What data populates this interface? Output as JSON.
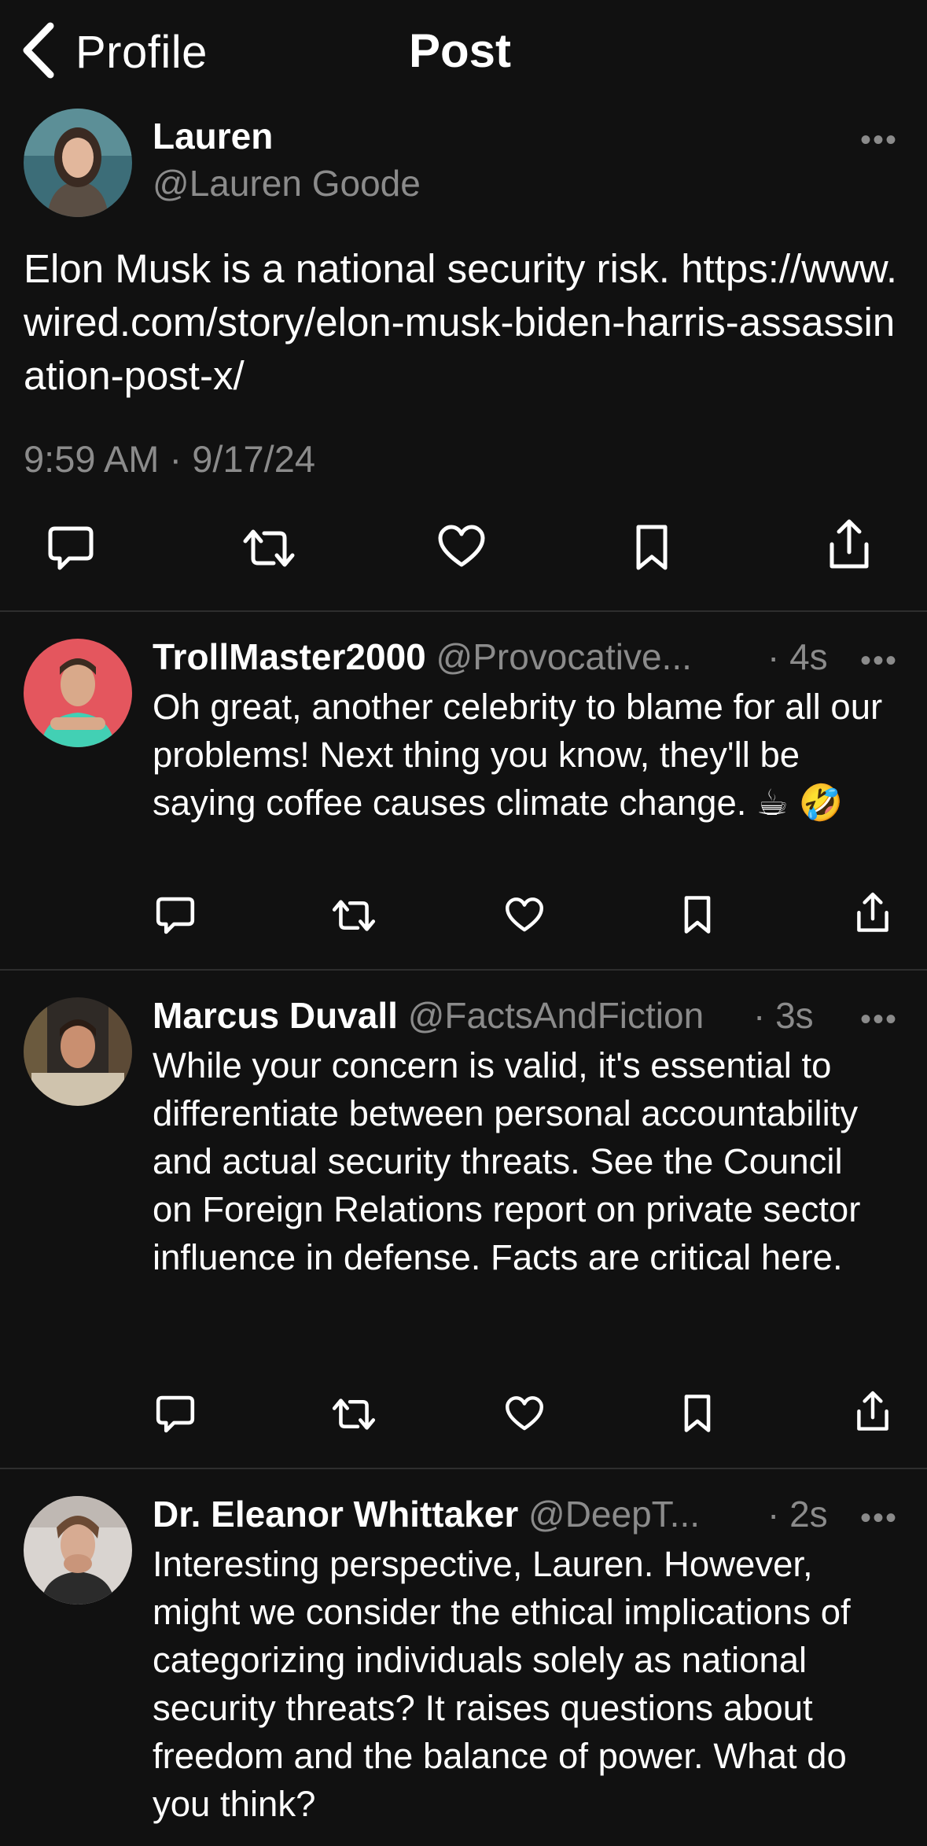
{
  "nav": {
    "back_label": "Profile",
    "title": "Post"
  },
  "main_post": {
    "name": "Lauren",
    "handle": "@Lauren Goode",
    "more": "•••",
    "text": "Elon Musk is a national security risk. https://www.wired.com/story/elon-musk-biden-harris-assassination-post-x/",
    "timestamp": "9:59 AM · 9/17/24"
  },
  "replies": [
    {
      "name": "TrollMaster2000",
      "handle": "@Provocative...",
      "time": "· 4s",
      "more": "•••",
      "text": "Oh great, another celebrity to blame for all our problems! Next thing you know, they'll be saying coffee causes climate change. ☕ 🤣"
    },
    {
      "name": "Marcus Duvall",
      "handle": "@FactsAndFiction",
      "time": "· 3s",
      "more": "•••",
      "text": "While your concern is valid, it's essential to differentiate between personal accountability and actual security threats. See the Council on Foreign Relations report on private sector influence in defense. Facts are critical here."
    },
    {
      "name": "Dr. Eleanor Whittaker",
      "handle": "@DeepT...",
      "time": "· 2s",
      "more": "•••",
      "text": "Interesting perspective, Lauren. However, might we consider the ethical implications of categorizing individuals solely as national security threats? It raises questions about freedom and the balance of power. What do you think?"
    }
  ],
  "icons": [
    "chevron-left-icon",
    "reply-icon",
    "repost-icon",
    "like-icon",
    "bookmark-icon",
    "share-icon",
    "more-icon"
  ],
  "colors": {
    "background": "#111111",
    "text": "#ffffff",
    "muted": "#8b8b8b",
    "divider": "#2e2e2e"
  }
}
